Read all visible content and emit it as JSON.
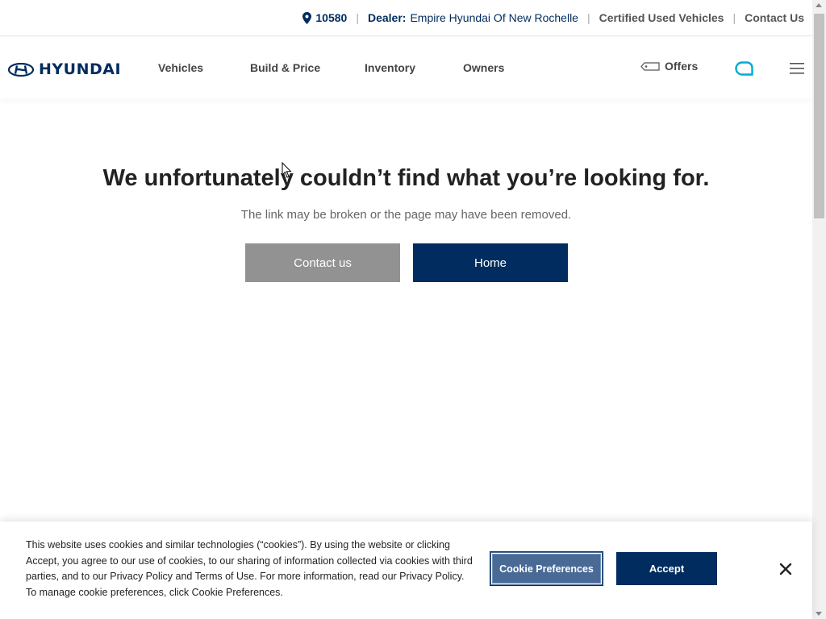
{
  "topbar": {
    "zip": "10580",
    "dealer_label": "Dealer:",
    "dealer_name": "Empire Hyundai Of New Rochelle",
    "certified": "Certified Used Vehicles",
    "contact": "Contact Us",
    "separator": "|"
  },
  "nav": {
    "logo_text": "HYUNDAI",
    "items": [
      "Vehicles",
      "Build & Price",
      "Inventory",
      "Owners"
    ],
    "offers": "Offers"
  },
  "main": {
    "headline": "We unfortunately couldn’t find what you’re looking for.",
    "subline": "The link may be broken or the page may have been removed.",
    "contact_button": "Contact us",
    "home_button": "Home"
  },
  "cookie": {
    "text": "This website uses cookies and similar technologies (“cookies”). By using the website or clicking Accept, you agree to our use of cookies, to our sharing of information collected via cookies with third parties, and to our Privacy Policy and Terms of Use. For more information, read our Privacy Policy. To manage cookie preferences, click Cookie Preferences.",
    "preferences_button": "Cookie Preferences",
    "accept_button": "Accept"
  },
  "colors": {
    "brand": "#002c5f",
    "gray_button": "#929292",
    "chat_teal": "#00aad2"
  }
}
